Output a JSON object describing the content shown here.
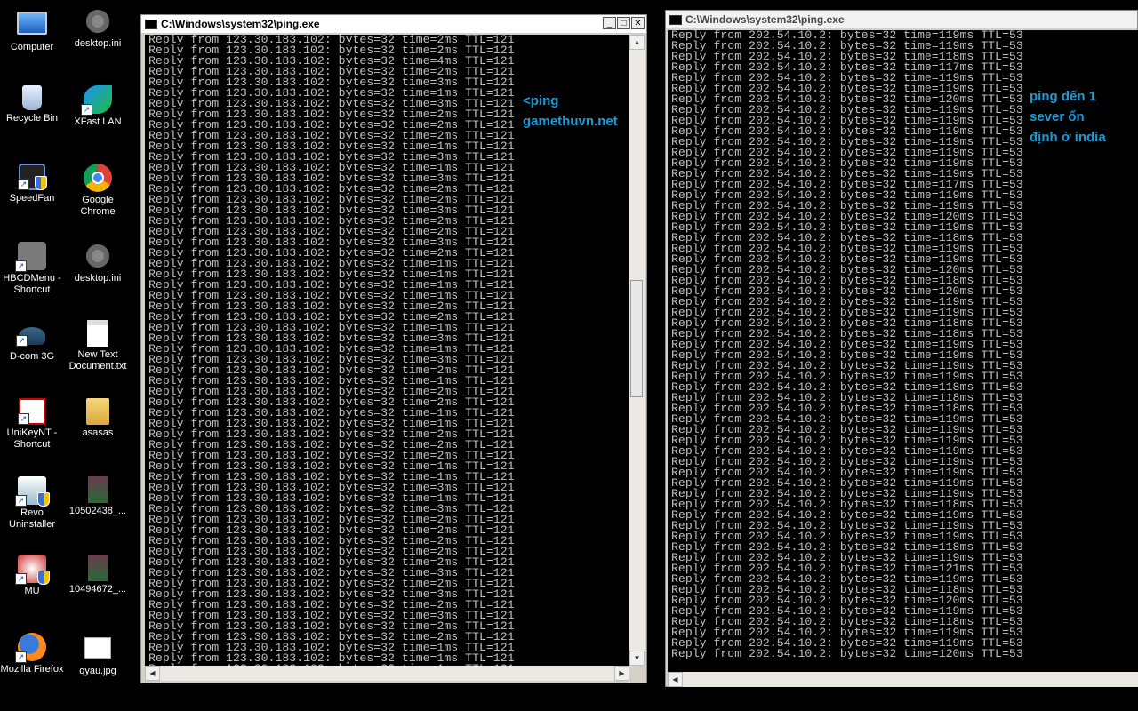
{
  "desktop": {
    "icons": [
      {
        "label": "Computer",
        "icon": "computer-icon"
      },
      {
        "label": "desktop.ini",
        "icon": "settings-file-icon"
      },
      {
        "label": "Recycle Bin",
        "icon": "recycle-bin-icon"
      },
      {
        "label": "XFast LAN",
        "icon": "xfast-lan-icon"
      },
      {
        "label": "SpeedFan",
        "icon": "speedfan-icon"
      },
      {
        "label": "Google\nChrome",
        "icon": "chrome-icon"
      },
      {
        "label": "HBCDMenu -\nShortcut",
        "icon": "hbcd-icon"
      },
      {
        "label": "desktop.ini",
        "icon": "settings-file-icon"
      },
      {
        "label": "D-com 3G",
        "icon": "dcom-icon"
      },
      {
        "label": "New Text\nDocument.txt",
        "icon": "text-document-icon"
      },
      {
        "label": "UniKeyNT -\nShortcut",
        "icon": "unikey-icon"
      },
      {
        "label": "asasas",
        "icon": "folder-icon"
      },
      {
        "label": "Revo\nUninstaller",
        "icon": "revo-icon"
      },
      {
        "label": "10502438_...",
        "icon": "image-file-icon"
      },
      {
        "label": "MU",
        "icon": "mu-game-icon"
      },
      {
        "label": "10494672_...",
        "icon": "image-file-icon"
      },
      {
        "label": "Mozilla Firefox",
        "icon": "firefox-icon"
      },
      {
        "label": "qyau.jpg",
        "icon": "image-file-icon"
      }
    ]
  },
  "windows": [
    {
      "title": "C:\\Windows\\system32\\ping.exe",
      "host": "123.30.183.102",
      "ttl": "121",
      "bytes": "32",
      "times": [
        "2ms",
        "2ms",
        "4ms",
        "2ms",
        "3ms",
        "1ms",
        "3ms",
        "2ms",
        "2ms",
        "2ms",
        "1ms",
        "3ms",
        "1ms",
        "3ms",
        "2ms",
        "2ms",
        "3ms",
        "2ms",
        "2ms",
        "3ms",
        "2ms",
        "1ms",
        "1ms",
        "1ms",
        "1ms",
        "2ms",
        "2ms",
        "1ms",
        "3ms",
        "1ms",
        "3ms",
        "2ms",
        "1ms",
        "2ms",
        "2ms",
        "1ms",
        "1ms",
        "2ms",
        "2ms",
        "2ms",
        "1ms",
        "1ms",
        "3ms",
        "1ms",
        "3ms",
        "2ms",
        "2ms",
        "2ms",
        "2ms",
        "2ms",
        "3ms",
        "2ms",
        "3ms",
        "2ms",
        "3ms",
        "2ms",
        "2ms",
        "1ms",
        "1ms",
        "1ms",
        "2ms",
        "1ms"
      ],
      "annotation": "<ping\ngamethuvn.net"
    },
    {
      "title": "C:\\Windows\\system32\\ping.exe",
      "host": "202.54.10.2",
      "ttl": "53",
      "bytes": "32",
      "times": [
        "119ms",
        "119ms",
        "118ms",
        "117ms",
        "119ms",
        "119ms",
        "120ms",
        "119ms",
        "119ms",
        "119ms",
        "119ms",
        "119ms",
        "119ms",
        "119ms",
        "117ms",
        "119ms",
        "119ms",
        "120ms",
        "119ms",
        "118ms",
        "119ms",
        "119ms",
        "120ms",
        "118ms",
        "120ms",
        "119ms",
        "119ms",
        "118ms",
        "118ms",
        "119ms",
        "119ms",
        "119ms",
        "119ms",
        "118ms",
        "118ms",
        "118ms",
        "119ms",
        "119ms",
        "119ms",
        "119ms",
        "119ms",
        "119ms",
        "119ms",
        "119ms",
        "118ms",
        "119ms",
        "119ms",
        "119ms",
        "118ms",
        "119ms",
        "121ms",
        "119ms",
        "118ms",
        "120ms",
        "119ms",
        "118ms",
        "119ms",
        "119ms",
        "120ms"
      ],
      "annotation": "ping đến 1\nsever ổn\nđịnh ở india"
    }
  ]
}
